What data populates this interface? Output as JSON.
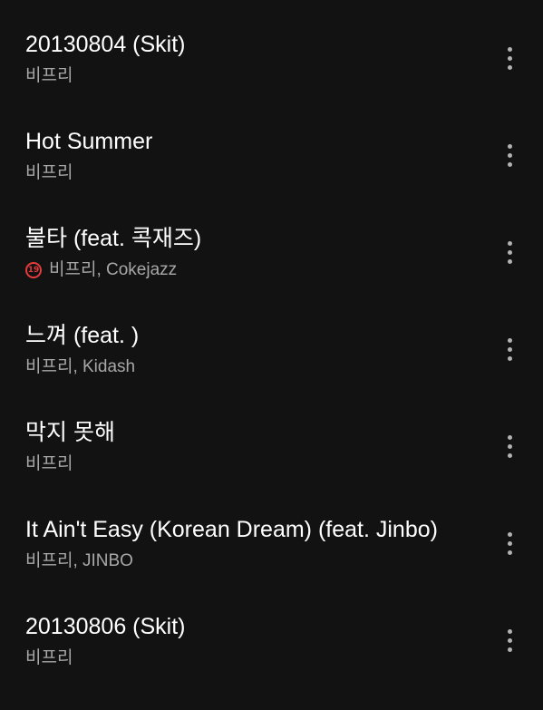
{
  "tracks": [
    {
      "title": "20130804 (Skit)",
      "artists": "비프리",
      "explicit": false
    },
    {
      "title": "Hot Summer",
      "artists": "비프리",
      "explicit": false
    },
    {
      "title": "불타 (feat. 콕재즈)",
      "artists": "비프리, Cokejazz",
      "explicit": true,
      "explicit_label": "19"
    },
    {
      "title": "느껴 (feat. )",
      "artists": "비프리, Kidash",
      "explicit": false
    },
    {
      "title": "막지 못해",
      "artists": "비프리",
      "explicit": false
    },
    {
      "title": "It Ain't Easy (Korean Dream) (feat. Jinbo)",
      "artists": "비프리, JINBO",
      "explicit": false
    },
    {
      "title": "20130806 (Skit)",
      "artists": "비프리",
      "explicit": false
    }
  ],
  "colors": {
    "background": "#121212",
    "title": "#ffffff",
    "subtitle": "#a7a7a7",
    "explicit": "#e33b3b",
    "more_icon": "#b3b3b3"
  }
}
